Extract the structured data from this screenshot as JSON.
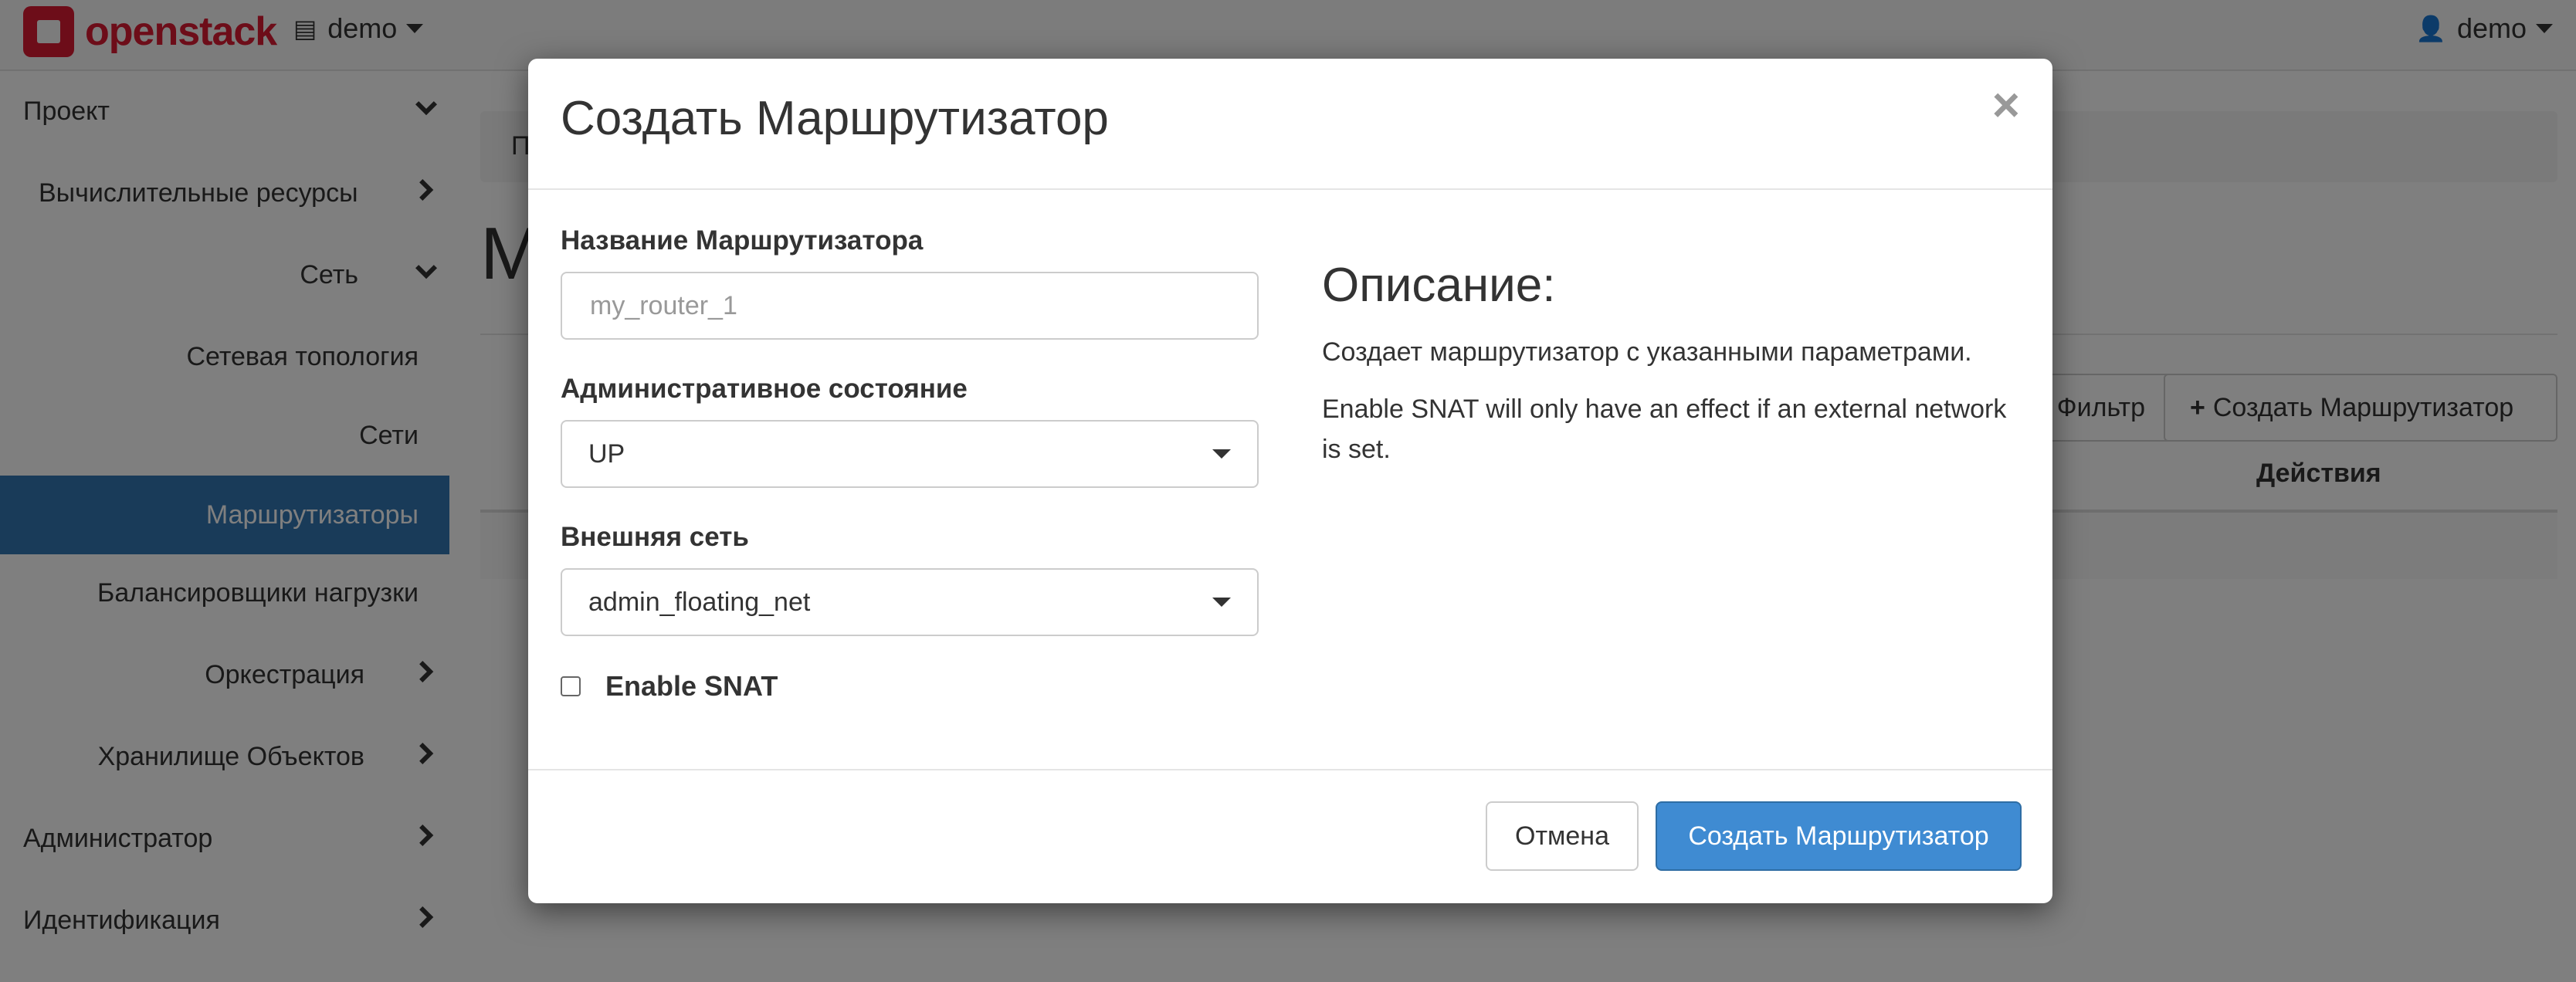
{
  "topbar": {
    "brand": "openstack",
    "project_label": "demo",
    "user_label": "demo"
  },
  "sidebar": {
    "items": [
      {
        "label": "Проект",
        "chevron": "down"
      },
      {
        "label": "Вычислительные ресурсы",
        "chevron": "right"
      },
      {
        "label": "Сеть",
        "chevron": "down"
      },
      {
        "label": "Сетевая топология",
        "chevron": ""
      },
      {
        "label": "Сети",
        "chevron": ""
      },
      {
        "label": "Маршрутизаторы",
        "chevron": "",
        "active": true
      },
      {
        "label": "Балансировщики нагрузки",
        "chevron": ""
      },
      {
        "label": "Оркестрация",
        "chevron": "right"
      },
      {
        "label": "Хранилище Объектов",
        "chevron": "right"
      },
      {
        "label": "Администратор",
        "chevron": "right"
      },
      {
        "label": "Идентификация",
        "chevron": "right"
      }
    ]
  },
  "background": {
    "breadcrumb_fragment": "П",
    "page_title_fragment": "М",
    "filter_button": "Фильтр",
    "create_button": "Создать Маршрутизатор",
    "actions_header": "Действия"
  },
  "modal": {
    "title": "Создать Маршрутизатор",
    "close_symbol": "×",
    "router_name": {
      "label": "Название Маршрутизатора",
      "placeholder": "my_router_1",
      "value": ""
    },
    "admin_state": {
      "label": "Административное состояние",
      "selected": "UP"
    },
    "external_network": {
      "label": "Внешняя сеть",
      "selected": "admin_floating_net"
    },
    "enable_snat": {
      "label": "Enable SNAT",
      "checked": false
    },
    "description": {
      "heading": "Описание:",
      "paragraph1": "Создает маршрутизатор с указанными параметрами.",
      "paragraph2": "Enable SNAT will only have an effect if an external network is set."
    },
    "footer": {
      "cancel_label": "Отмена",
      "submit_label": "Создать Маршрутизатор"
    }
  },
  "colors": {
    "brand": "#da1a32",
    "active_nav": "#3277b3",
    "primary_button": "#3f8bd2"
  }
}
